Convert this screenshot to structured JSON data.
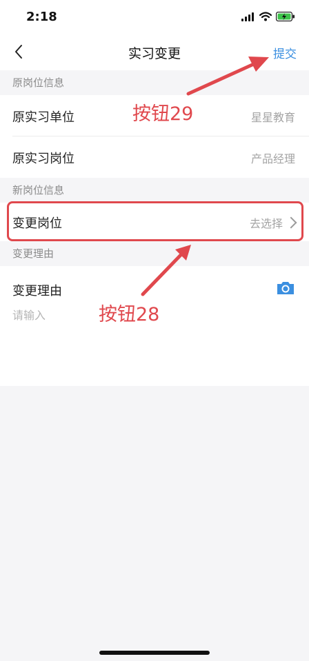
{
  "status": {
    "time": "2:18"
  },
  "nav": {
    "title": "实习变更",
    "submit_label": "提交"
  },
  "sections": {
    "original_header": "原岗位信息",
    "new_header": "新岗位信息",
    "reason_header": "变更理由"
  },
  "original": {
    "company_label": "原实习单位",
    "company_value": "星星教育",
    "position_label": "原实习岗位",
    "position_value": "产品经理"
  },
  "new_position": {
    "label": "变更岗位",
    "value": "去选择"
  },
  "reason": {
    "label": "变更理由",
    "placeholder": "请输入"
  },
  "annotations": {
    "button_29": "按钮29",
    "button_28": "按钮28"
  },
  "icons": [
    "signal-icon",
    "wifi-icon",
    "battery-charging-icon",
    "back-chevron-icon",
    "chevron-right-icon",
    "camera-icon"
  ],
  "colors": {
    "accent": "#3b8fe0",
    "annotation": "#e0484d",
    "background": "#f5f5f7"
  }
}
